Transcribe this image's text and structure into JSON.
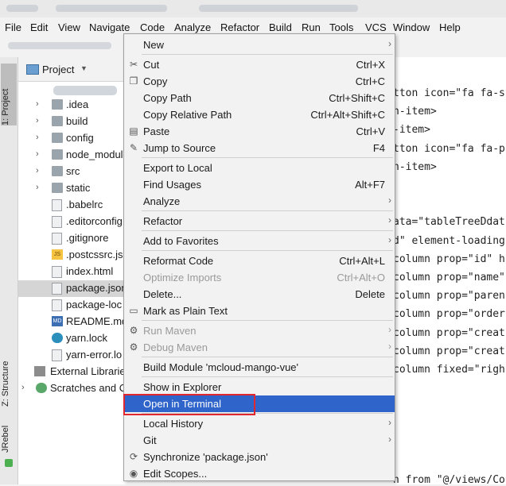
{
  "menubar": [
    "File",
    "Edit",
    "View",
    "Navigate",
    "Code",
    "Analyze",
    "Refactor",
    "Build",
    "Run",
    "Tools",
    "VCS",
    "Window",
    "Help"
  ],
  "left_tool_tabs": [
    "1: Project",
    "Z: Structure",
    "JRebel"
  ],
  "project_panel": {
    "title": "Project",
    "tree": [
      {
        "label": ".idea",
        "kind": "folder",
        "expandable": true
      },
      {
        "label": "build",
        "kind": "folder",
        "expandable": true
      },
      {
        "label": "config",
        "kind": "folder",
        "expandable": true
      },
      {
        "label": "node_modul",
        "kind": "folder",
        "expandable": true
      },
      {
        "label": "src",
        "kind": "folder",
        "expandable": true
      },
      {
        "label": "static",
        "kind": "folder",
        "expandable": true
      },
      {
        "label": ".babelrc",
        "kind": "file"
      },
      {
        "label": ".editorconfig",
        "kind": "file"
      },
      {
        "label": ".gitignore",
        "kind": "file"
      },
      {
        "label": ".postcssrc.js",
        "kind": "js"
      },
      {
        "label": "index.html",
        "kind": "file"
      },
      {
        "label": "package.json",
        "kind": "file",
        "selected": true
      },
      {
        "label": "package-loc",
        "kind": "file"
      },
      {
        "label": "README.md",
        "kind": "md"
      },
      {
        "label": "yarn.lock",
        "kind": "yarn"
      },
      {
        "label": "yarn-error.lo",
        "kind": "file"
      },
      {
        "label": "External Librarie",
        "kind": "lib"
      },
      {
        "label": "Scratches and C",
        "kind": "scr",
        "expandable": true
      }
    ]
  },
  "editor_lines": [
    "tton icon=\"fa fa-s",
    "n-item>",
    "-item>",
    "tton icon=\"fa fa-p",
    "n-item>",
    "",
    "",
    "ata=\"tableTreeDdat",
    "d\" element-loading",
    "column prop=\"id\" h",
    "column prop=\"name\"",
    "column prop=\"paren",
    "column prop=\"order",
    "column prop=\"creat",
    "column prop=\"creat",
    "column fixed=\"righ",
    "",
    "",
    "",
    "",
    "",
    "n from \"@/views/Co"
  ],
  "context_menu": {
    "items": [
      {
        "label": "New",
        "submenu": true
      },
      {
        "sep": true
      },
      {
        "label": "Cut",
        "shortcut": "Ctrl+X",
        "icon": "scissors-icon",
        "glyph": "✂"
      },
      {
        "label": "Copy",
        "shortcut": "Ctrl+C",
        "icon": "copy-icon",
        "glyph": "❐"
      },
      {
        "label": "Copy Path",
        "shortcut": "Ctrl+Shift+C"
      },
      {
        "label": "Copy Relative Path",
        "shortcut": "Ctrl+Alt+Shift+C"
      },
      {
        "label": "Paste",
        "shortcut": "Ctrl+V",
        "icon": "paste-icon",
        "glyph": "▤"
      },
      {
        "label": "Jump to Source",
        "shortcut": "F4",
        "icon": "pencil-icon",
        "glyph": "✎"
      },
      {
        "sep": true
      },
      {
        "label": "Export to Local"
      },
      {
        "label": "Find Usages",
        "shortcut": "Alt+F7"
      },
      {
        "label": "Analyze",
        "submenu": true
      },
      {
        "sep": true
      },
      {
        "label": "Refactor",
        "submenu": true
      },
      {
        "sep": true
      },
      {
        "label": "Add to Favorites",
        "submenu": true
      },
      {
        "sep": true
      },
      {
        "label": "Reformat Code",
        "shortcut": "Ctrl+Alt+L"
      },
      {
        "label": "Optimize Imports",
        "shortcut": "Ctrl+Alt+O",
        "disabled": true
      },
      {
        "label": "Delete...",
        "shortcut": "Delete"
      },
      {
        "label": "Mark as Plain Text",
        "icon": "plain-text-icon",
        "glyph": "▭"
      },
      {
        "sep": true
      },
      {
        "label": "Run Maven",
        "submenu": true,
        "disabled": true,
        "icon": "gear-icon",
        "glyph": "⚙"
      },
      {
        "label": "Debug Maven",
        "submenu": true,
        "disabled": true,
        "icon": "gear-icon",
        "glyph": "⚙"
      },
      {
        "sep": true
      },
      {
        "label": "Build Module 'mcloud-mango-vue'"
      },
      {
        "sep": true
      },
      {
        "label": "Show in Explorer"
      },
      {
        "label": "Open in Terminal",
        "highlighted": true,
        "icon": "terminal-icon",
        "glyph": "▣"
      },
      {
        "sep": true
      },
      {
        "label": "Local History",
        "submenu": true
      },
      {
        "label": "Git",
        "submenu": true
      },
      {
        "label": "Synchronize 'package.json'",
        "icon": "sync-icon",
        "glyph": "⟳"
      },
      {
        "label": "Edit Scopes...",
        "icon": "scope-icon",
        "glyph": "◉"
      }
    ]
  },
  "colors": {
    "highlight": "#2f65ca",
    "annotation_box": "#e0262e"
  }
}
